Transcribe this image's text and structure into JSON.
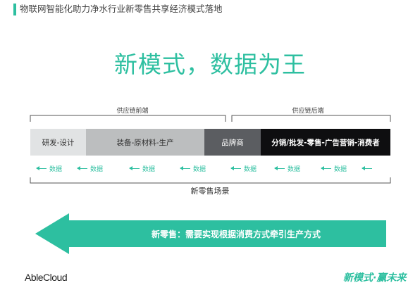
{
  "header": {
    "title": "物联网智能化助力净水行业新零售共享经济模式落地"
  },
  "main_title": "新模式，数据为王",
  "brackets": {
    "front": "供应链前端",
    "back": "供应链后端"
  },
  "chain": {
    "rd": "研发-设计",
    "equipment": "装备-原材料-生产",
    "brand": "品牌商",
    "distribution": "分销/批发-零售-广告营销-消费者"
  },
  "flow": {
    "label": "数据"
  },
  "scene_label": "新零售场景",
  "banner": {
    "text": "新零售：需要实现根据消费方式牵引生产方式"
  },
  "logos": {
    "left": "AbleCloud",
    "right": "新模式·赢未来"
  },
  "colors": {
    "accent": "#2dbfa0",
    "seg_rd": "#e1e3e4",
    "seg_equip": "#bcbebf",
    "seg_brand": "#5b5d61",
    "seg_dist": "#0e0e10"
  }
}
